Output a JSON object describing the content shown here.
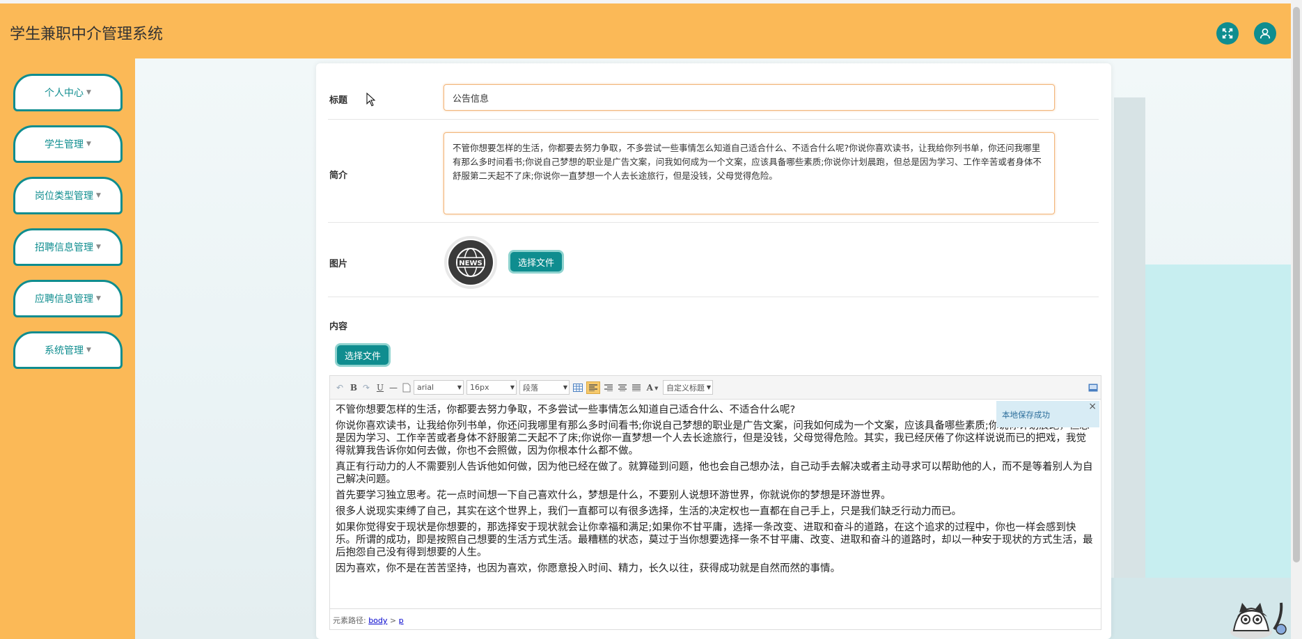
{
  "app": {
    "title": "学生兼职中介管理系统"
  },
  "header": {
    "icons": [
      "fullscreen-icon",
      "user-icon"
    ]
  },
  "sidebar": {
    "items": [
      {
        "label": "个人中心"
      },
      {
        "label": "学生管理"
      },
      {
        "label": "岗位类型管理"
      },
      {
        "label": "招聘信息管理"
      },
      {
        "label": "应聘信息管理"
      },
      {
        "label": "系统管理"
      }
    ],
    "caret": "▼"
  },
  "form": {
    "title_label": "标题",
    "title_value": "公告信息",
    "intro_label": "简介",
    "intro_value": "不管你想要怎样的生活，你都要去努力争取，不多尝试一些事情怎么知道自己适合什么、不适合什么呢?你说你喜欢读书，让我给你列书单，你还问我哪里有那么多时间看书;你说自己梦想的职业是广告文案，问我如何成为一个文案，应该具备哪些素质;你说你计划晨跑，但总是因为学习、工作辛苦或者身体不舒服第二天起不了床;你说你一直梦想一个人去长途旅行，但是没钱，父母觉得危险。",
    "image_label": "图片",
    "image_badge": "NEWS",
    "choose_file": "选择文件",
    "content_label": "内容",
    "content_choose_file": "选择文件"
  },
  "editor": {
    "toolbar": {
      "bold": "B",
      "underline": "U",
      "font_family": "arial",
      "font_size": "16px",
      "paragraph": "段落",
      "font_color": "A",
      "custom_title": "自定义标题"
    },
    "paragraphs": [
      "不管你想要怎样的生活，你都要去努力争取，不多尝试一些事情怎么知道自己适合什么、不适合什么呢?",
      "你说你喜欢读书，让我给你列书单，你还问我哪里有那么多时间看书;你说自己梦想的职业是广告文案，问我如何成为一个文案，应该具备哪些素质;你说你计划晨跑，但总是因为学习、工作辛苦或者身体不舒服第二天起不了床;你说你一直梦想一个人去长途旅行，但是没钱，父母觉得危险。其实，我已经厌倦了你这样说说而已的把戏，我觉得就算我告诉你如何去做，你也不会照做，因为你根本什么都不做。",
      "真正有行动力的人不需要别人告诉他如何做，因为他已经在做了。就算碰到问题，他也会自己想办法，自己动手去解决或者主动寻求可以帮助他的人，而不是等着别人为自己解决问题。",
      "首先要学习独立思考。花一点时间想一下自己喜欢什么，梦想是什么，不要别人说想环游世界，你就说你的梦想是环游世界。",
      "很多人说现实束缚了自己，其实在这个世界上，我们一直都可以有很多选择，生活的决定权也一直都在自己手上，只是我们缺乏行动力而已。",
      "如果你觉得安于现状是你想要的，那选择安于现状就会让你幸福和满足;如果你不甘平庸，选择一条改变、进取和奋斗的道路，在这个追求的过程中，你也一样会感到快乐。所谓的成功，即是按照自己想要的生活方式生活。最糟糕的状态，莫过于当你想要选择一条不甘平庸、改变、进取和奋斗的道路时，却以一种安于现状的方式生活，最后抱怨自己没有得到想要的人生。",
      "因为喜欢，你不是在苦苦坚持，也因为喜欢，你愿意投入时间、精力，长久以往，获得成功就是自然而然的事情。"
    ],
    "save_tip": "本地保存成功",
    "save_tip_close": "×",
    "path_label": "元素路径: ",
    "path_body": "body",
    "path_sep": " > ",
    "path_p": "p"
  },
  "colors": {
    "header_bg": "#fbb957",
    "accent": "#0f8d8f",
    "input_border": "#f2b57a"
  }
}
